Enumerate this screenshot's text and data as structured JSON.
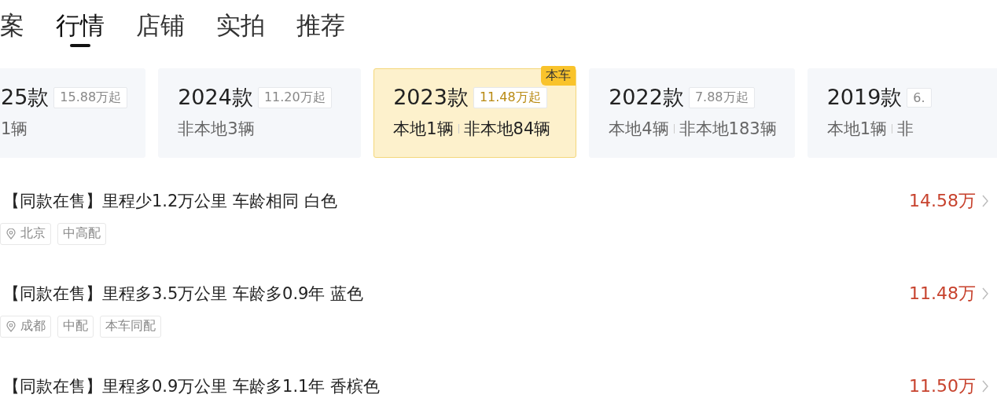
{
  "tabs": [
    {
      "label": "案",
      "selected": false
    },
    {
      "label": "行情",
      "selected": true
    },
    {
      "label": "店铺",
      "selected": false
    },
    {
      "label": "实拍",
      "selected": false
    },
    {
      "label": "推荐",
      "selected": false
    }
  ],
  "model_years": [
    {
      "year": "25款",
      "price": "15.88万起",
      "counts": [
        "1辆"
      ],
      "selected": false
    },
    {
      "year": "2024款",
      "price": "11.20万起",
      "counts": [
        "非本地3辆"
      ],
      "selected": false
    },
    {
      "year": "2023款",
      "price": "11.48万起",
      "counts": [
        "本地1辆",
        "非本地84辆"
      ],
      "selected": true,
      "badge": "本车"
    },
    {
      "year": "2022款",
      "price": "7.88万起",
      "counts": [
        "本地4辆",
        "非本地183辆"
      ],
      "selected": false
    },
    {
      "year": "2019款",
      "price": "6.",
      "counts": [
        "本地1辆",
        "非"
      ],
      "selected": false
    }
  ],
  "listings": [
    {
      "title": "【同款在售】里程少1.2万公里 车龄相同 白色",
      "price": "14.58万",
      "tags": [
        {
          "kind": "location",
          "text": "北京"
        },
        {
          "kind": "plain",
          "text": "中高配"
        }
      ]
    },
    {
      "title": "【同款在售】里程多3.5万公里 车龄多0.9年 蓝色",
      "price": "11.48万",
      "tags": [
        {
          "kind": "location",
          "text": "成都"
        },
        {
          "kind": "plain",
          "text": "中配"
        },
        {
          "kind": "plain",
          "text": "本车同配"
        }
      ]
    },
    {
      "title": "【同款在售】里程多0.9万公里 车龄多1.1年 香槟色",
      "price": "11.50万"
    }
  ]
}
